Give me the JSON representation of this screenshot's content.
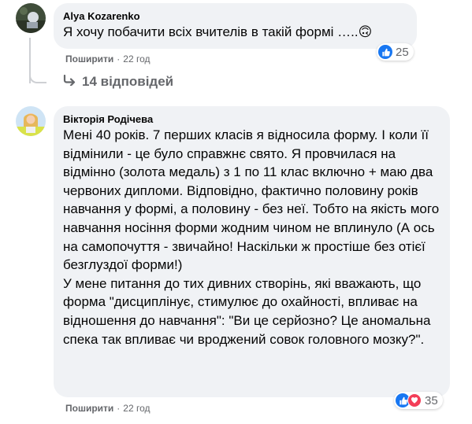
{
  "comments": [
    {
      "author": "Alya Kozarenko",
      "text": "Я хочу побачити всіх вчителів в такій формі …..",
      "emoji": "🙃",
      "share_label": "Поширити",
      "time": "22 год",
      "reactions_count": "25",
      "reaction_types": [
        "like"
      ]
    },
    {
      "author": "Вікторія Родічева",
      "text": "Мені 40 років. 7 перших класів я відносила форму. І коли її відмінили - це було справжнє свято. Я провчилася на відмінно (золота медаль) з 1 по 11 клас включно + маю два червоних дипломи. Відповідно, фактично половину років навчання у формі, а половину - без неї. Тобто на якість мого навчання носіння форми жодним чином не вплинуло (А ось на самопочуття - звичайно! Наскільки ж простіше без отієї безглуздої форми!)\nУ мене питання до тих дивних створінь, які вважають, що форма \"дисциплінує, стимулює до охайності, впливає на відношення до навчання\": \"Ви це серйозно? Це аномальна спека так впливає чи вроджений совок головного мозку?\".",
      "share_label": "Поширити",
      "time": "22 год",
      "reactions_count": "35",
      "reaction_types": [
        "like",
        "love"
      ]
    }
  ],
  "replies_toggle": "14 відповідей",
  "meta_separator": "·",
  "colors": {
    "like": "#1877f2",
    "love": "#f33e58",
    "bubble": "#f0f2f5",
    "secondary_text": "#65676b"
  }
}
